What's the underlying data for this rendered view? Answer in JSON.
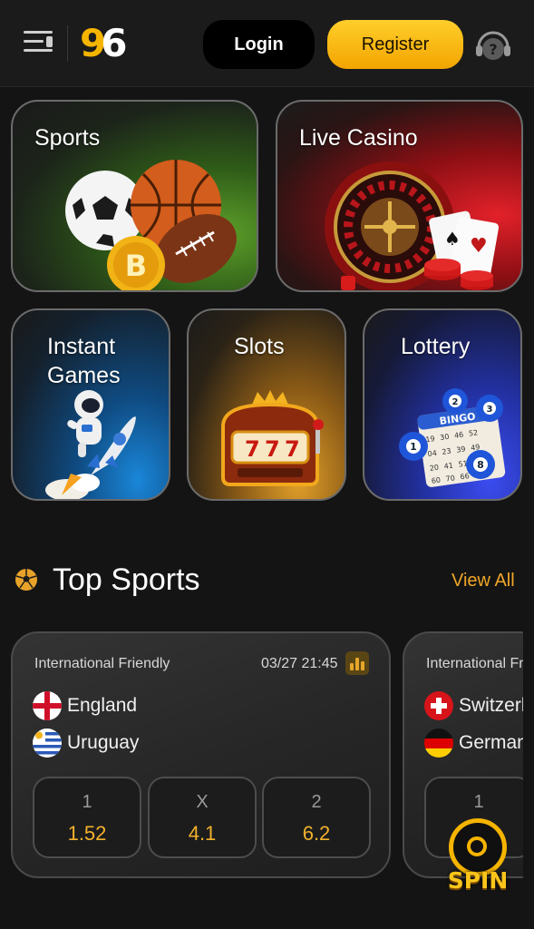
{
  "header": {
    "logo_first": "9",
    "logo_second": "6",
    "login_label": "Login",
    "register_label": "Register"
  },
  "categories": [
    {
      "label": "Sports",
      "icon": "sports-balls-icon"
    },
    {
      "label": "Live Casino",
      "icon": "roulette-icon"
    },
    {
      "label": "Instant Games",
      "icon": "astronaut-rocket-icon"
    },
    {
      "label": "Slots",
      "icon": "slot-machine-icon"
    },
    {
      "label": "Lottery",
      "icon": "bingo-icon"
    }
  ],
  "top_sports": {
    "title": "Top Sports",
    "view_all": "View All"
  },
  "matches": [
    {
      "league": "International Friendly",
      "time": "03/27 21:45",
      "home": "England",
      "away": "Uruguay",
      "odds": [
        {
          "label": "1",
          "value": "1.52"
        },
        {
          "label": "X",
          "value": "4.1"
        },
        {
          "label": "2",
          "value": "6.2"
        }
      ]
    },
    {
      "league": "International Friendly",
      "home": "Switzerland",
      "away": "Germany",
      "odds": [
        {
          "label": "1"
        }
      ]
    }
  ],
  "spin_label": "SPIN",
  "colors": {
    "accent": "#f5b400",
    "odds_value": "#f2b12c",
    "background": "#141414"
  }
}
